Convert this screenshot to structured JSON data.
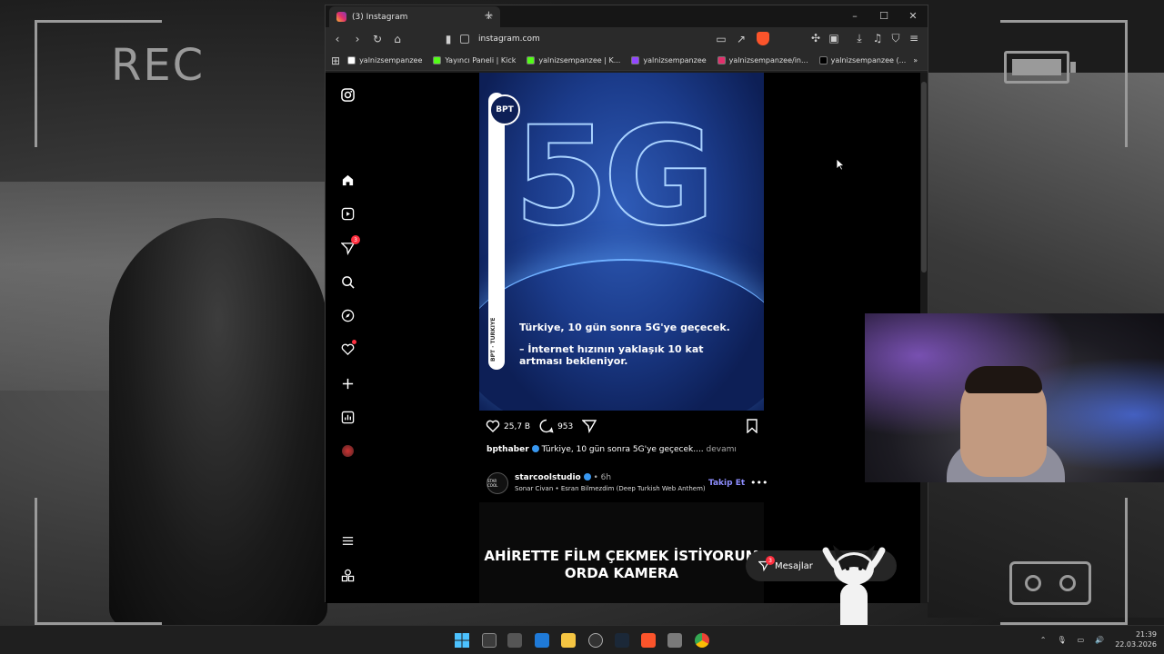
{
  "overlay": {
    "rec_label": "REC"
  },
  "browser": {
    "tab_title": "(3) Instagram",
    "tab_close": "×",
    "new_tab": "+",
    "window_controls": [
      "–",
      "☐",
      "✕"
    ],
    "url": "instagram.com",
    "bookmarks": [
      {
        "label": "yalnizsempanzee",
        "color": "#ffffff"
      },
      {
        "label": "Yayıncı Paneli | Kick",
        "color": "#53fc18"
      },
      {
        "label": "yalnizsempanzee | K...",
        "color": "#53fc18"
      },
      {
        "label": "yalnizsempanzee",
        "color": "#9146ff"
      },
      {
        "label": "yalnizsempanzee/in...",
        "color": "#e1306c"
      },
      {
        "label": "yalnizsempanzee (...",
        "color": "#000000"
      }
    ],
    "bookmarks_more": "»"
  },
  "instagram": {
    "sidebar": {
      "notification_badge": "3"
    },
    "post1": {
      "logo_text": "BPT",
      "headline": "5G",
      "vertical_label": "BPT · TÜRKİYE",
      "text_line1": "Türkiye, 10 gün sonra 5G'ye geçecek.",
      "text_line2": "– İnternet hızının yaklaşık 10 kat artması bekleniyor.",
      "likes": "25,7 B",
      "comments": "953",
      "caption_user": "bpthaber",
      "caption_text": "Türkiye, 10 gün sonra 5G'ye geçecek....",
      "caption_more": "devamı"
    },
    "post2": {
      "avatar_text": "STAR COOL",
      "username": "starcoolstudio",
      "time": "• 6h",
      "audio": "Sonar Civan • Esran Bilmezdim (Deep Turkish Web Anthem)",
      "follow": "Takip Et",
      "more": "•••",
      "image_text": "AHİRETTE FİLM ÇEKMEK İSTİYORUM ORDA KAMERA"
    },
    "messages": {
      "label": "Mesajlar",
      "badge": "3"
    }
  },
  "taskbar": {
    "time": "21:39",
    "date": "22.03.2026"
  }
}
